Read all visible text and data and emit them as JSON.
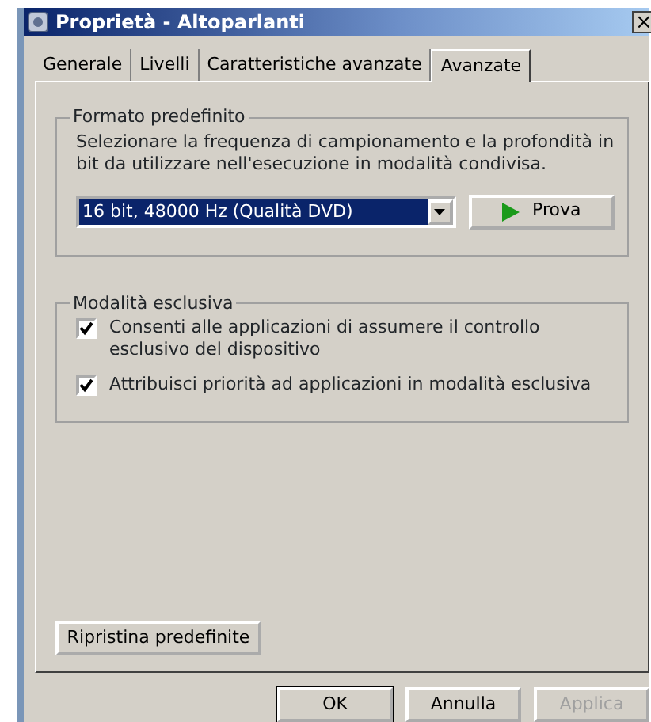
{
  "window": {
    "title": "Proprietà - Altoparlanti",
    "close": "×"
  },
  "tabs": [
    {
      "label": "Generale",
      "selected": false
    },
    {
      "label": "Livelli",
      "selected": false
    },
    {
      "label": "Caratteristiche avanzate",
      "selected": false
    },
    {
      "label": "Avanzate",
      "selected": true
    }
  ],
  "default_format": {
    "title": "Formato predefinito",
    "description": "Selezionare la frequenza di campionamento e la profondità in bit da utilizzare nell'esecuzione in modalità condivisa.",
    "format_value": "16 bit, 48000 Hz (Qualità DVD)",
    "test_button": "Prova"
  },
  "exclusive_mode": {
    "title": "Modalità esclusiva",
    "options": [
      {
        "label": "Consenti alle applicazioni di assumere il controllo esclusivo del dispositivo",
        "checked": true
      },
      {
        "label": "Attribuisci priorità ad applicazioni in modalità esclusiva",
        "checked": true
      }
    ]
  },
  "restore_button": "Ripristina predefinite",
  "buttons": [
    {
      "label": "OK",
      "disabled": false
    },
    {
      "label": "Annulla",
      "disabled": false
    },
    {
      "label": "Applica",
      "disabled": true
    }
  ]
}
